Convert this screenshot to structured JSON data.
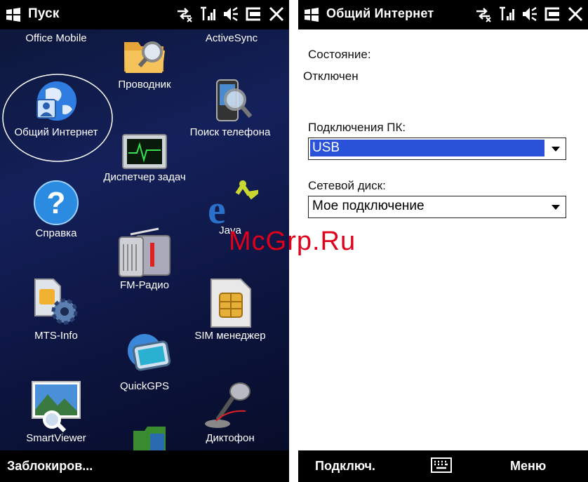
{
  "left_screen": {
    "title": "Пуск",
    "apps": [
      {
        "label": "Office Mobile"
      },
      {
        "label": "Проводник"
      },
      {
        "label": "ActiveSync"
      },
      {
        "label": "Общий Интернет"
      },
      {
        "label": "Поиск телефона"
      },
      {
        "label": "Диспетчер задач"
      },
      {
        "label": "Справка"
      },
      {
        "label": "Java"
      },
      {
        "label": "FM-Радио"
      },
      {
        "label": "MTS-Info"
      },
      {
        "label": "SIM менеджер"
      },
      {
        "label": "QuickGPS"
      },
      {
        "label": "SmartViewer"
      },
      {
        "label": "Диктофон"
      }
    ],
    "bottom_left": "Заблокиров..."
  },
  "right_screen": {
    "title": "Общий Интернет",
    "state_label": "Состояние:",
    "state_value": "Отключен",
    "pc_conn_label": "Подключения ПК:",
    "pc_conn_value": "USB",
    "net_disk_label": "Сетевой диск:",
    "net_disk_value": "Мое подключение",
    "softkey_left": "Подключ.",
    "softkey_right": "Меню"
  },
  "watermark": "McGrp.Ru",
  "colors": {
    "selection": "#2a52d8",
    "watermark": "#e0001a",
    "bar": "#000000"
  }
}
